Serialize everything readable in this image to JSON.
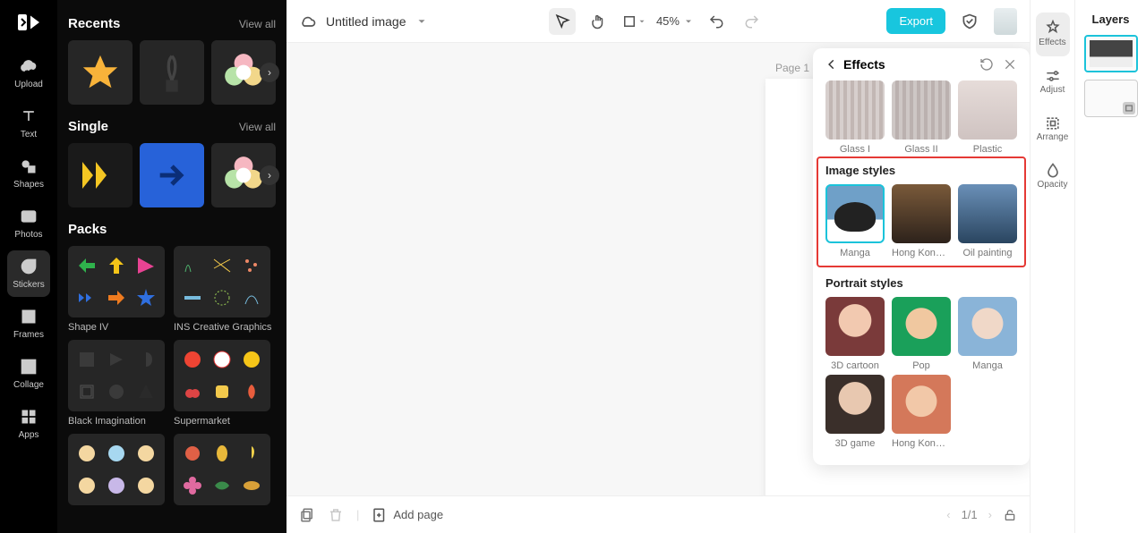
{
  "app": {
    "title": "Untitled image"
  },
  "nav": [
    {
      "label": "Upload"
    },
    {
      "label": "Text"
    },
    {
      "label": "Shapes"
    },
    {
      "label": "Photos"
    },
    {
      "label": "Stickers"
    },
    {
      "label": "Frames"
    },
    {
      "label": "Collage"
    },
    {
      "label": "Apps"
    }
  ],
  "side": {
    "recents": {
      "title": "Recents",
      "view_all": "View all"
    },
    "single": {
      "title": "Single",
      "view_all": "View all"
    },
    "packs": {
      "title": "Packs",
      "items": [
        {
          "label": "Shape IV"
        },
        {
          "label": "INS Creative Graphics"
        },
        {
          "label": "Black Imagination"
        },
        {
          "label": "Supermarket"
        }
      ]
    }
  },
  "top": {
    "zoom": "45%",
    "export": "Export"
  },
  "canvas": {
    "page_label": "Page 1"
  },
  "bottom": {
    "add_page": "Add page",
    "pages": "1/1"
  },
  "rightbar": [
    {
      "label": "Effects"
    },
    {
      "label": "Adjust"
    },
    {
      "label": "Arrange"
    },
    {
      "label": "Opacity"
    }
  ],
  "layers": {
    "title": "Layers"
  },
  "effects": {
    "title": "Effects",
    "glass": [
      {
        "label": "Glass I"
      },
      {
        "label": "Glass II"
      },
      {
        "label": "Plastic"
      }
    ],
    "image_styles": {
      "title": "Image styles",
      "items": [
        {
          "label": "Manga"
        },
        {
          "label": "Hong Kong ..."
        },
        {
          "label": "Oil painting"
        }
      ]
    },
    "portrait_styles": {
      "title": "Portrait styles",
      "items": [
        {
          "label": "3D cartoon"
        },
        {
          "label": "Pop"
        },
        {
          "label": "Manga"
        },
        {
          "label": "3D game"
        },
        {
          "label": "Hong Kong ..."
        }
      ]
    }
  }
}
